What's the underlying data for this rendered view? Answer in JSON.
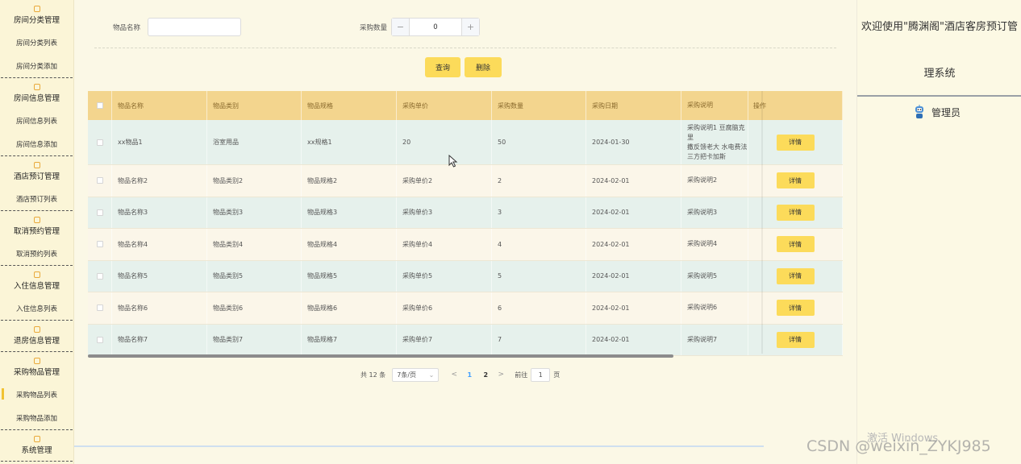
{
  "sidebar": {
    "groups": [
      {
        "title": "房间分类管理",
        "items": [
          "房间分类列表",
          "房间分类添加"
        ]
      },
      {
        "title": "房间信息管理",
        "items": [
          "房间信息列表",
          "房间信息添加"
        ]
      },
      {
        "title": "酒店预订管理",
        "items": [
          "酒店预订列表"
        ]
      },
      {
        "title": "取消预约管理",
        "items": [
          "取消预约列表"
        ]
      },
      {
        "title": "入住信息管理",
        "items": [
          "入住信息列表"
        ]
      },
      {
        "title": "退房信息管理",
        "items": []
      },
      {
        "title": "采购物品管理",
        "items": [
          "采购物品列表",
          "采购物品添加"
        ]
      },
      {
        "title": "系统管理",
        "items": []
      }
    ],
    "active_item": "采购物品列表"
  },
  "search": {
    "name_label": "物品名称",
    "name_value": "",
    "qty_label": "采购数量",
    "qty_value": "0",
    "minus": "−",
    "plus": "+",
    "search_button": "查询",
    "delete_button": "删除"
  },
  "table": {
    "headers": [
      "物品名称",
      "物品类别",
      "物品规格",
      "采购单价",
      "采购数量",
      "采购日期",
      "采购说明",
      "操作"
    ],
    "rows": [
      [
        "xx物品1",
        "浴室用品",
        "xx规格1",
        "20",
        "50",
        "2024-01-30",
        "采购说明1 豆腐脑克里\n撒反馈老大 水电费法\n三方把卡加斯"
      ],
      [
        "物品名称2",
        "物品类别2",
        "物品规格2",
        "采购单价2",
        "2",
        "2024-02-01",
        "采购说明2"
      ],
      [
        "物品名称3",
        "物品类别3",
        "物品规格3",
        "采购单价3",
        "3",
        "2024-02-01",
        "采购说明3"
      ],
      [
        "物品名称4",
        "物品类别4",
        "物品规格4",
        "采购单价4",
        "4",
        "2024-02-01",
        "采购说明4"
      ],
      [
        "物品名称5",
        "物品类别5",
        "物品规格5",
        "采购单价5",
        "5",
        "2024-02-01",
        "采购说明5"
      ],
      [
        "物品名称6",
        "物品类别6",
        "物品规格6",
        "采购单价6",
        "6",
        "2024-02-01",
        "采购说明6"
      ],
      [
        "物品名称7",
        "物品类别7",
        "物品规格7",
        "采购单价7",
        "7",
        "2024-02-01",
        "采购说明7"
      ]
    ],
    "detail_button": "详情"
  },
  "pagination": {
    "total": "共 12 条",
    "page_size": "7条/页",
    "prev": "<",
    "next": ">",
    "pages": [
      "1",
      "2"
    ],
    "current_page": "1",
    "goto_label": "前往",
    "goto_value": "1",
    "goto_suffix": "页"
  },
  "header": {
    "welcome_line1": "欢迎使用\"腾渊阁\"酒店客房预订管",
    "welcome_line2": "理系统",
    "user": "管理员"
  },
  "watermark": {
    "windows": "激活 Windows",
    "csdn": "CSDN @weixin_ZYKJ985"
  },
  "colors": {
    "accent": "#fcdb5a",
    "header_bg": "#f3d58e",
    "row_odd": "#e6f1ec",
    "row_even": "#fbf6e9",
    "page_active": "#409eff"
  }
}
